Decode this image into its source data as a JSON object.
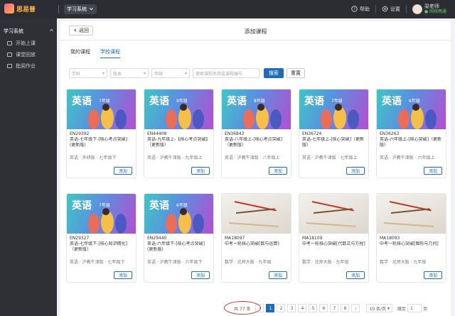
{
  "topbar": {
    "logo_text": "思易普",
    "system_switch": "学习系统",
    "help": "帮助",
    "settings": "设置",
    "user_name": "梁老师",
    "user_status": "网络畅通"
  },
  "sidebar": {
    "section": "学习系统",
    "items": [
      {
        "label": "开始上课",
        "icon": "monitor-icon"
      },
      {
        "label": "课堂回放",
        "icon": "playback-icon"
      },
      {
        "label": "批阅作业",
        "icon": "homework-icon"
      }
    ]
  },
  "header": {
    "back_label": "返回",
    "title": "添加课程"
  },
  "tabs": [
    {
      "label": "我的课程",
      "active": false
    },
    {
      "label": "学校课程",
      "active": true
    }
  ],
  "filters": {
    "subject_placeholder": "学科",
    "edition_placeholder": "版本",
    "grade_placeholder": "年级",
    "search_placeholder": "搜索课程名称或课程编号",
    "search_button": "搜索",
    "reset_button": "重置"
  },
  "add_label": "添加",
  "courses": [
    {
      "code": "EN29392",
      "name": "英语-七年级下-[核心考点突破](更新版)",
      "meta": "英语 · 外研版 · 七年级下",
      "cover": "en",
      "cover_title": "英语",
      "cover_grade": "7年级"
    },
    {
      "code": "EN44408",
      "name": "英语-九年级上-【核心考点突破】（更新版）",
      "meta": "英语 · 沪教牛津版 · 九年级上",
      "cover": "en",
      "cover_title": "英语",
      "cover_grade": "9年级"
    },
    {
      "code": "EN36843",
      "name": "英语-八年级上-[核心考点突破]（更新版）",
      "meta": "英语 · 沪教牛津版 · 八年级上",
      "cover": "en",
      "cover_title": "英语",
      "cover_grade": "8年级"
    },
    {
      "code": "EN36724",
      "name": "英语-七年级上-[核心突破]（更新版）",
      "meta": "英语 · 沪教牛津版 · 七年级上",
      "cover": "en",
      "cover_title": "英语",
      "cover_grade": "7年级"
    },
    {
      "code": "EN36263",
      "name": "英语-六年级上-[核心突破]（更新版）",
      "meta": "英语 · 沪教牛津版 · 六年级上",
      "cover": "en",
      "cover_title": "英语",
      "cover_grade": "6年级"
    },
    {
      "code": "EN29327",
      "name": "英语-七年级下-[核心知识精化]（更新版）",
      "meta": "英语 · 沪教牛津版 · 七年级下",
      "cover": "en",
      "cover_title": "英语",
      "cover_grade": "7年级"
    },
    {
      "code": "EN29440",
      "name": "英语-六年级下-[核心考点突破](更新版)",
      "meta": "英语 · 沪教牛津版 · 六年级下",
      "cover": "en",
      "cover_title": "英语",
      "cover_grade": "6年级"
    },
    {
      "code": "MA18097",
      "name": "中考一轮核心突破[数与运算]",
      "meta": "数学 · 北师大版 · 九年级",
      "cover": "math",
      "cover_title": "",
      "cover_grade": ""
    },
    {
      "code": "MA18109",
      "name": "中考一轮核心突破[代数式与方程]",
      "meta": "数学 · 北师大版 · 九年级",
      "cover": "math",
      "cover_title": "",
      "cover_grade": ""
    },
    {
      "code": "MA18093",
      "name": "中考一轮核心突破[图形与几何]",
      "meta": "数学 · 北师大版 · 九年级",
      "cover": "math",
      "cover_title": "",
      "cover_grade": ""
    }
  ],
  "pagination": {
    "total": "共 77 条",
    "prev": "‹",
    "pages": [
      "1",
      "2",
      "3",
      "4",
      "5",
      "6",
      "7",
      "8"
    ],
    "active_page": "1",
    "next": "›",
    "per_page": "10 条/页",
    "goto_label": "跳至",
    "goto_value": "1",
    "page_suffix": "页"
  },
  "colors": {
    "accent": "#1e6bb8",
    "topbar": "#2b2d33",
    "sidebar": "#2e3036",
    "highlight_ring": "#d0342c"
  }
}
